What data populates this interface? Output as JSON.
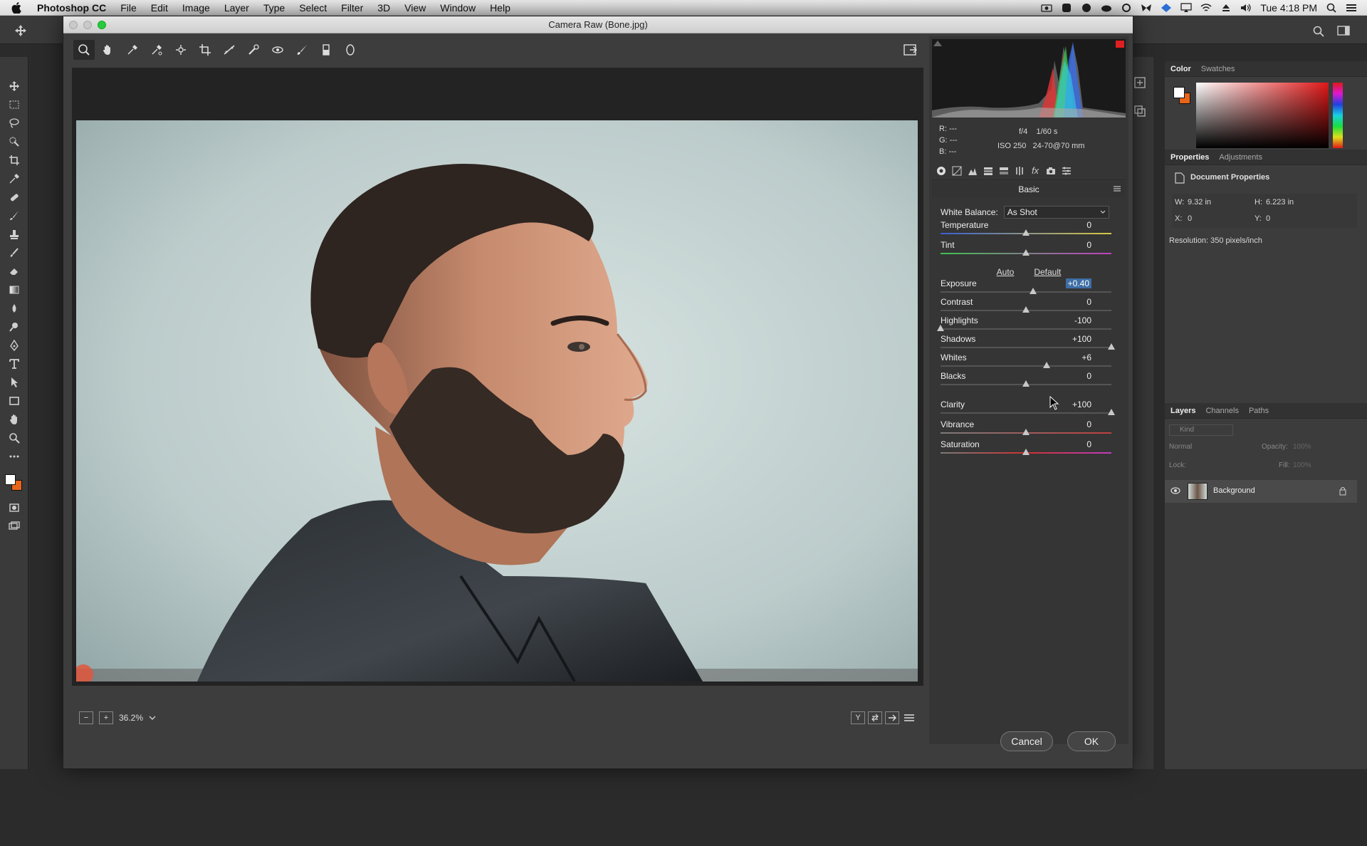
{
  "menubar": {
    "app_name": "Photoshop CC",
    "items": [
      "File",
      "Edit",
      "Image",
      "Layer",
      "Type",
      "Select",
      "Filter",
      "3D",
      "View",
      "Window",
      "Help"
    ],
    "clock": "Tue 4:18 PM"
  },
  "ps_panels": {
    "color_tab": "Color",
    "swatches_tab": "Swatches",
    "properties_tab": "Properties",
    "adjustments_tab": "Adjustments",
    "doc_props_label": "Document Properties",
    "w_label": "W:",
    "w_value": "9.32 in",
    "h_label": "H:",
    "h_value": "6.223 in",
    "x_label": "X:",
    "x_value": "0",
    "y_label": "Y:",
    "y_value": "0",
    "resolution": "Resolution: 350 pixels/inch",
    "layers_tab": "Layers",
    "channels_tab": "Channels",
    "paths_tab": "Paths",
    "kind_placeholder": "Kind",
    "blend_mode": "Normal",
    "opacity_label": "Opacity:",
    "opacity_value": "100%",
    "lock_label": "Lock:",
    "fill_label": "Fill:",
    "fill_value": "100%",
    "layer_name": "Background"
  },
  "dialog": {
    "title": "Camera Raw (Bone.jpg)",
    "zoom": "36.2%",
    "cancel_label": "Cancel",
    "ok_label": "OK"
  },
  "cam_info": {
    "r_label": "R:",
    "g_label": "G:",
    "b_label": "B:",
    "r_value": "---",
    "g_value": "---",
    "b_value": "---",
    "aperture": "f/4",
    "shutter": "1/60 s",
    "iso": "ISO 250",
    "lens": "24-70@70 mm"
  },
  "basic": {
    "section_title": "Basic",
    "wb_label": "White Balance:",
    "wb_value": "As Shot",
    "auto_label": "Auto",
    "default_label": "Default",
    "sliders": [
      {
        "label": "Temperature",
        "value": "0",
        "pos": 0.5
      },
      {
        "label": "Tint",
        "value": "0",
        "pos": 0.5
      },
      {
        "label": "Exposure",
        "value": "+0.40",
        "pos": 0.54
      },
      {
        "label": "Contrast",
        "value": "0",
        "pos": 0.5
      },
      {
        "label": "Highlights",
        "value": "-100",
        "pos": 0.0
      },
      {
        "label": "Shadows",
        "value": "+100",
        "pos": 1.0
      },
      {
        "label": "Whites",
        "value": "+6",
        "pos": 0.62
      },
      {
        "label": "Blacks",
        "value": "0",
        "pos": 0.5
      },
      {
        "label": "Clarity",
        "value": "+100",
        "pos": 1.0
      },
      {
        "label": "Vibrance",
        "value": "0",
        "pos": 0.5
      },
      {
        "label": "Saturation",
        "value": "0",
        "pos": 0.5
      }
    ]
  },
  "colors": {
    "accent_blue": "#3e6ea5",
    "foreground_swatch": "#ffffff",
    "background_swatch": "#e8641a"
  }
}
